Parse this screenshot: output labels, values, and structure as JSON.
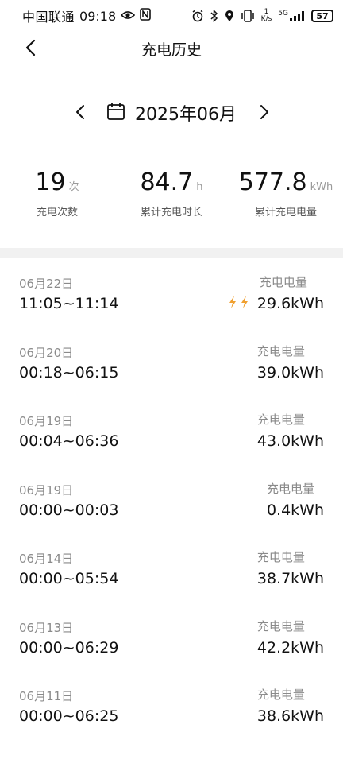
{
  "status_bar": {
    "carrier": "中国联通",
    "time": "09:18",
    "net_speed_top": "1",
    "net_speed_bottom": "K/s",
    "network_type": "5G",
    "battery": "57",
    "icons": [
      "eye-icon",
      "nfc-icon",
      "alarm-icon",
      "bluetooth-icon",
      "location-icon",
      "vibrate-icon",
      "signal-icon"
    ]
  },
  "header": {
    "title": "充电历史",
    "back_icon": "chevron-left-icon"
  },
  "month_selector": {
    "month_label": "2025年06月",
    "prev_icon": "chevron-left-icon",
    "next_icon": "chevron-right-icon",
    "calendar_icon": "calendar-icon"
  },
  "stats": [
    {
      "value": "19",
      "unit": "次",
      "label": "充电次数"
    },
    {
      "value": "84.7",
      "unit": "h",
      "label": "累计充电时长"
    },
    {
      "value": "577.8",
      "unit": "kWh",
      "label": "累计充电电量"
    }
  ],
  "records": [
    {
      "date": "06月22日",
      "time_range": "11:05~11:14",
      "energy_label": "充电电量",
      "energy": "29.6kWh",
      "fast_charge": true
    },
    {
      "date": "06月20日",
      "time_range": "00:18~06:15",
      "energy_label": "充电电量",
      "energy": "39.0kWh",
      "fast_charge": false
    },
    {
      "date": "06月19日",
      "time_range": "00:04~06:36",
      "energy_label": "充电电量",
      "energy": "43.0kWh",
      "fast_charge": false
    },
    {
      "date": "06月19日",
      "time_range": "00:00~00:03",
      "energy_label": "充电电量",
      "energy": "0.4kWh",
      "fast_charge": false
    },
    {
      "date": "06月14日",
      "time_range": "00:00~05:54",
      "energy_label": "充电电量",
      "energy": "38.7kWh",
      "fast_charge": false
    },
    {
      "date": "06月13日",
      "time_range": "00:00~06:29",
      "energy_label": "充电电量",
      "energy": "42.2kWh",
      "fast_charge": false
    },
    {
      "date": "06月11日",
      "time_range": "00:00~06:25",
      "energy_label": "充电电量",
      "energy": "38.6kWh",
      "fast_charge": false
    }
  ],
  "colors": {
    "bolt": "#f0a030",
    "divider": "#f1f1f1",
    "muted_text": "#8a8a8a"
  }
}
